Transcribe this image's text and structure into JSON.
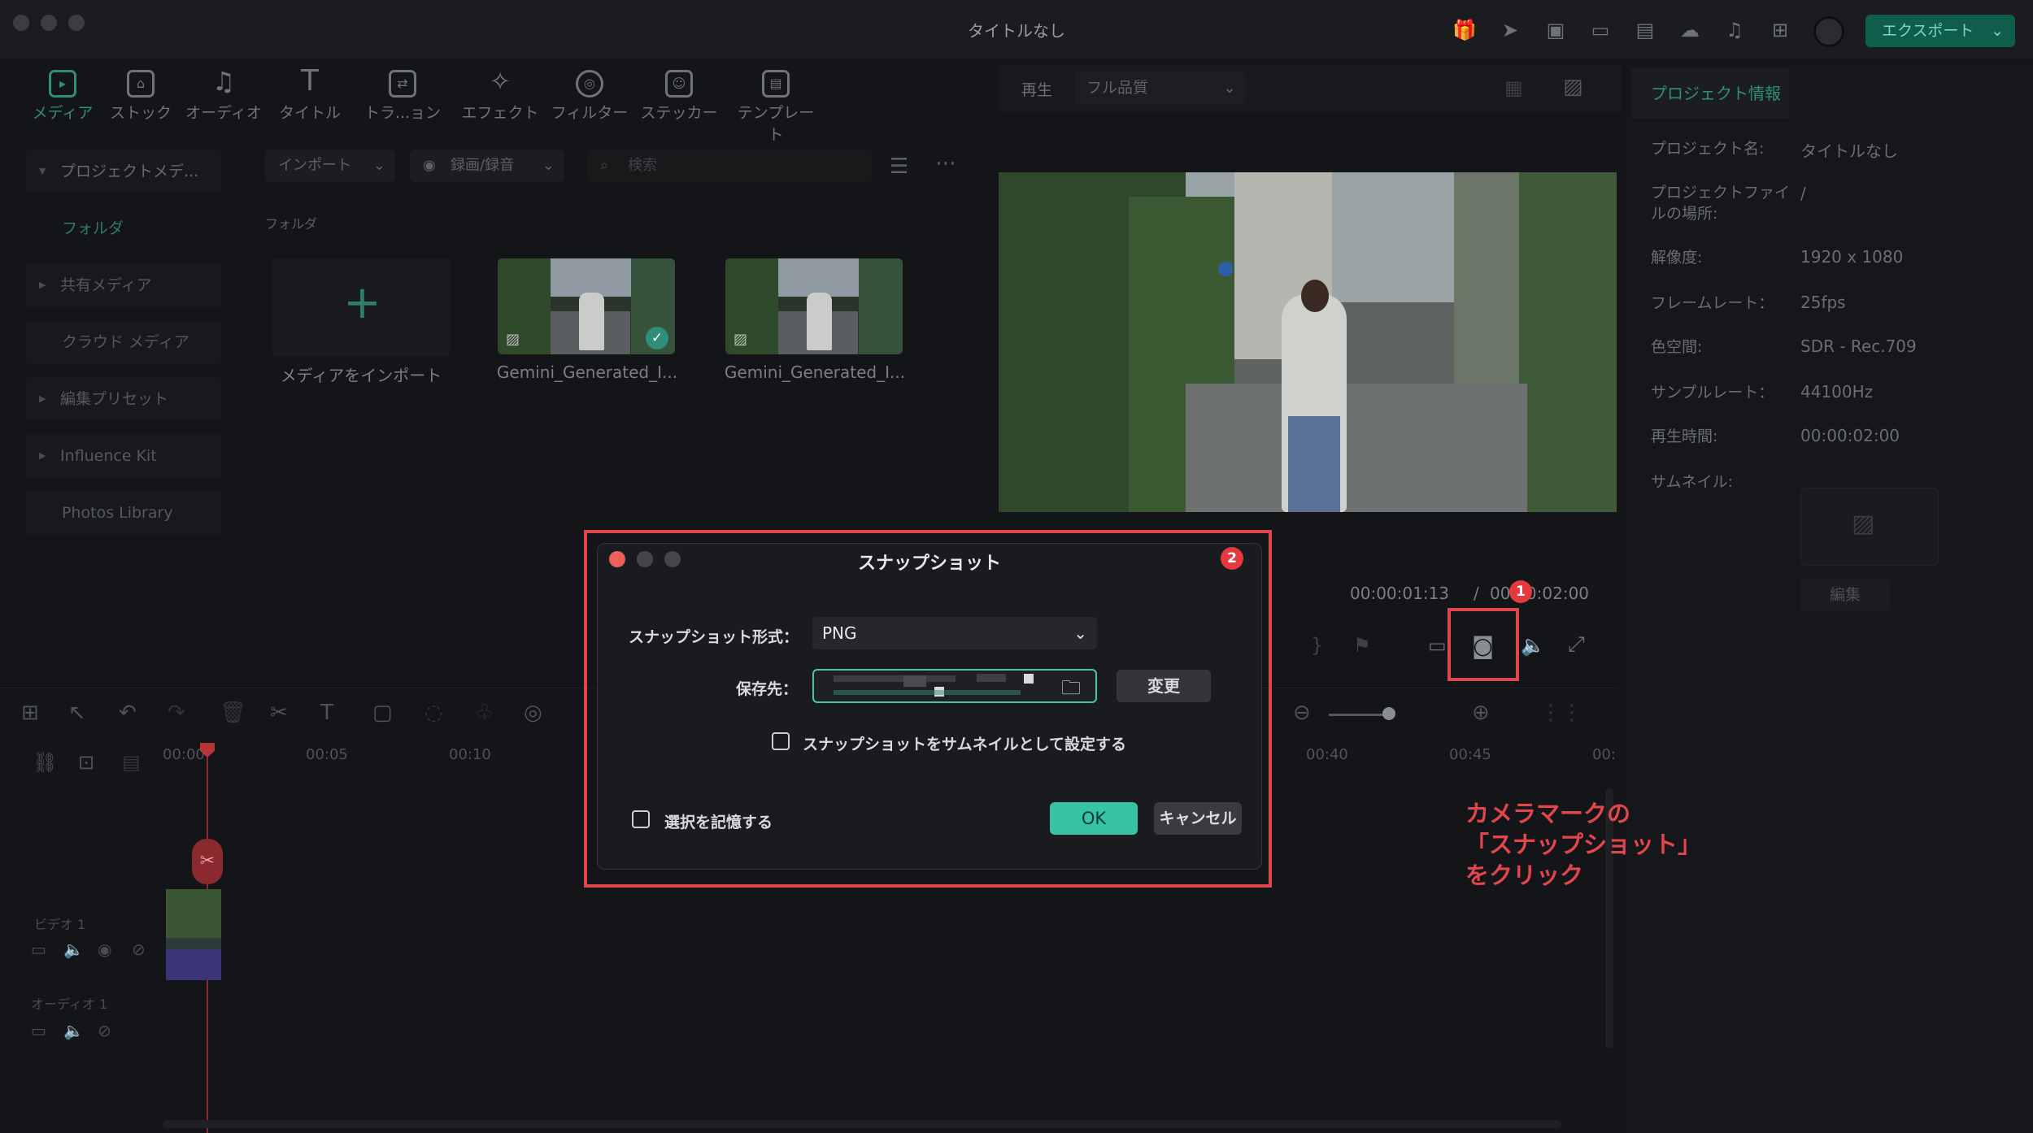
{
  "window": {
    "title": "タイトルなし",
    "export_label": "エクスポート"
  },
  "top_tabs": [
    {
      "label": "メディア",
      "icon": "media-icon"
    },
    {
      "label": "ストック",
      "icon": "stock-icon"
    },
    {
      "label": "オーディオ",
      "icon": "audio-icon"
    },
    {
      "label": "タイトル",
      "icon": "title-icon"
    },
    {
      "label": "トラ...ョン",
      "icon": "transition-icon"
    },
    {
      "label": "エフェクト",
      "icon": "effect-icon"
    },
    {
      "label": "フィルター",
      "icon": "filter-icon"
    },
    {
      "label": "ステッカー",
      "icon": "sticker-icon"
    },
    {
      "label": "テンプレート",
      "icon": "template-icon"
    }
  ],
  "sidebar": {
    "items": [
      {
        "label": "プロジェクトメデ..."
      },
      {
        "label": "フォルダ"
      },
      {
        "label": "共有メディア"
      },
      {
        "label": "クラウド メディア"
      },
      {
        "label": "編集プリセット"
      },
      {
        "label": "Influence Kit"
      },
      {
        "label": "Photos Library"
      }
    ]
  },
  "media": {
    "import_label": "インポート",
    "record_label": "録画/録音",
    "search_placeholder": "検索",
    "folder_label": "フォルダ",
    "import_tile_label": "メディアをインポート",
    "clips": [
      {
        "name": "Gemini_Generated_I..."
      },
      {
        "name": "Gemini_Generated_I..."
      }
    ]
  },
  "player": {
    "play_label": "再生",
    "quality": "フル品質",
    "current_time": "00:00:01:13",
    "separator": "/",
    "total_time": "00:00:02:00"
  },
  "project_info": {
    "tab": "プロジェクト情報",
    "rows": [
      {
        "key": "プロジェクト名:",
        "value": "タイトルなし"
      },
      {
        "key": "プロジェクトファイルの場所:",
        "value": "/"
      },
      {
        "key": "解像度:",
        "value": "1920 x 1080"
      },
      {
        "key": "フレームレート：",
        "value": "25fps"
      },
      {
        "key": "色空間:",
        "value": "SDR - Rec.709"
      },
      {
        "key": "サンプルレート：",
        "value": "44100Hz"
      },
      {
        "key": "再生時間:",
        "value": "00:00:02:00"
      },
      {
        "key": "サムネイル:",
        "value": ""
      }
    ],
    "edit_label": "編集"
  },
  "timeline": {
    "ticks": [
      "00:00",
      "00:05",
      "00:10",
      "00:40",
      "00:45",
      "00:"
    ],
    "tracks": [
      {
        "label": "ビデオ 1"
      },
      {
        "label": "オーディオ 1"
      }
    ]
  },
  "dialog": {
    "title": "スナップショット",
    "format_label": "スナップショット形式：",
    "format_value": "PNG",
    "save_label": "保存先：",
    "change_label": "変更",
    "thumbnail_checkbox": "スナップショットをサムネイルとして設定する",
    "remember_checkbox": "選択を記憶する",
    "ok_label": "OK",
    "cancel_label": "キャンセル"
  },
  "annotations": {
    "badge1": "1",
    "badge2": "2",
    "note_lines": [
      "カメラマークの",
      "「スナップショット」",
      "をクリック"
    ],
    "color": "#e0464c"
  },
  "colors": {
    "accent": "#36c4a4",
    "highlight": "#e0464c",
    "background": "#141518"
  }
}
